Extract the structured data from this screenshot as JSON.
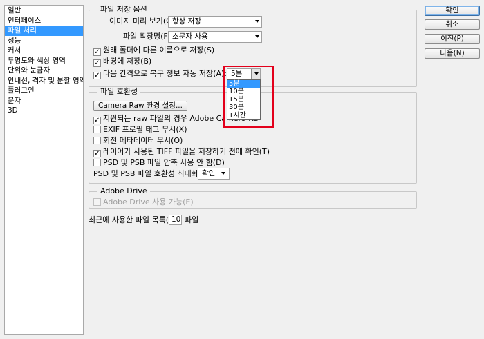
{
  "sidebar": {
    "items": [
      {
        "label": "일반"
      },
      {
        "label": "인터페이스"
      },
      {
        "label": "파일 처리"
      },
      {
        "label": "성능"
      },
      {
        "label": "커서"
      },
      {
        "label": "투명도와 색상 영역"
      },
      {
        "label": "단위와 눈금자"
      },
      {
        "label": "안내선, 격자 및 분할 영역"
      },
      {
        "label": "플러그인"
      },
      {
        "label": "문자"
      },
      {
        "label": "3D"
      }
    ],
    "selected_index": 2
  },
  "file_save": {
    "title": "파일 저장 옵션",
    "preview_label": "이미지 미리 보기(G):",
    "preview_value": "항상 저장",
    "extension_label": "파일 확장명(F):",
    "extension_value": "소문자 사용",
    "save_original_folder": {
      "label": "원래 폴더에 다른 이름으로 저장(S)",
      "checked": true
    },
    "save_background": {
      "label": "배경에 저장(B)",
      "checked": true
    },
    "autosave": {
      "label": "다음 간격으로 복구 정보 자동 저장(A):",
      "checked": true
    },
    "autosave_value": "5분",
    "autosave_options": [
      "5분",
      "10분",
      "15분",
      "30분",
      "1시간"
    ],
    "autosave_highlight_index": 0
  },
  "compat": {
    "title": "파일 호환성",
    "camera_raw_button": "Camera Raw 환경 설정...",
    "raw_supported": {
      "label": "지원되는 raw 파일의 경우 Adobe Camera Ra",
      "checked": true
    },
    "ignore_exif": {
      "label": "EXIF 프로필 태그 무시(X)",
      "checked": false
    },
    "ignore_rotation": {
      "label": "회전 메타데이터 무시(O)",
      "checked": false
    },
    "ask_tiff_layers": {
      "label": "레이어가 사용된 TIFF 파일을 저장하기 전에 확인(T)",
      "checked": true
    },
    "disable_psd_compression": {
      "label": "PSD 및 PSB 파일 압축 사용 안 함(D)",
      "checked": false
    },
    "maximize_label": "PSD 및 PSB 파일 호환성 최대화(M):",
    "maximize_value": "확인"
  },
  "drive": {
    "title": "Adobe Drive",
    "enable": {
      "label": "Adobe Drive 사용 가능(E)",
      "checked": false
    }
  },
  "recent": {
    "label": "최근에 사용한 파일 목록(R):",
    "value": "10",
    "unit": "파일"
  },
  "buttons": {
    "ok": "확인",
    "cancel": "취소",
    "prev": "이전(P)",
    "next": "다음(N)"
  },
  "colors": {
    "selection": "#3399ff",
    "annotation_box": "#e3001b"
  }
}
